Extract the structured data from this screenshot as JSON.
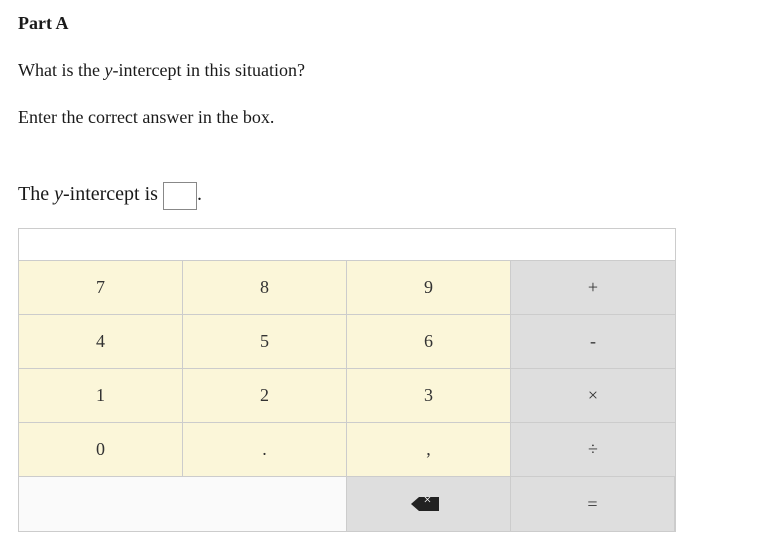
{
  "header": {
    "part_label": "Part A"
  },
  "question": {
    "line1_prefix": "What is the ",
    "line1_var": "y",
    "line1_suffix": "-intercept in this situation?",
    "instruction": "Enter the correct answer in the box."
  },
  "answer": {
    "prefix": "The ",
    "var": "y",
    "mid": "-intercept is ",
    "value": "",
    "suffix": "."
  },
  "keypad": {
    "keys": {
      "k7": "7",
      "k8": "8",
      "k9": "9",
      "plus": "+",
      "k4": "4",
      "k5": "5",
      "k6": "6",
      "minus": "-",
      "k1": "1",
      "k2": "2",
      "k3": "3",
      "times": "×",
      "k0": "0",
      "dot": ".",
      "comma": ",",
      "divide": "÷",
      "equals": "="
    }
  }
}
